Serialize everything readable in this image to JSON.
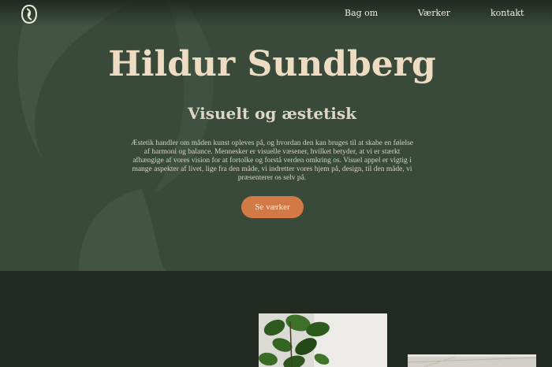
{
  "nav": {
    "logo_icon": "leaf-logo-icon",
    "links": [
      {
        "label": "Bag om"
      },
      {
        "label": "Værker"
      },
      {
        "label": "kontakt"
      }
    ]
  },
  "hero": {
    "title": "Hildur Sundberg",
    "subtitle": "Visuelt og æstetisk",
    "body": "Æstetik handler om måden kunst opleves på, og hvordan den kan bruges til at skabe en følelse af harmoni og balance. Mennesker er visuelle væsener, hvilket betyder, at vi er stærkt afhængige af vores vision for at fortolke og forstå verden omkring os. Visuel appel er vigtig i mange aspekter af livet, lige fra den måde, vi indretter vores hjem på, design, til den måde, vi præsenterer os selv på.",
    "cta_label": "Se værker"
  },
  "colors": {
    "hero_bg": "#394a3b",
    "page_bg": "#222a23",
    "title": "#eddcc2",
    "accent": "#d27a45"
  },
  "gallery": {
    "images": [
      {
        "icon": "plant-photo"
      },
      {
        "icon": "room-photo"
      }
    ]
  }
}
